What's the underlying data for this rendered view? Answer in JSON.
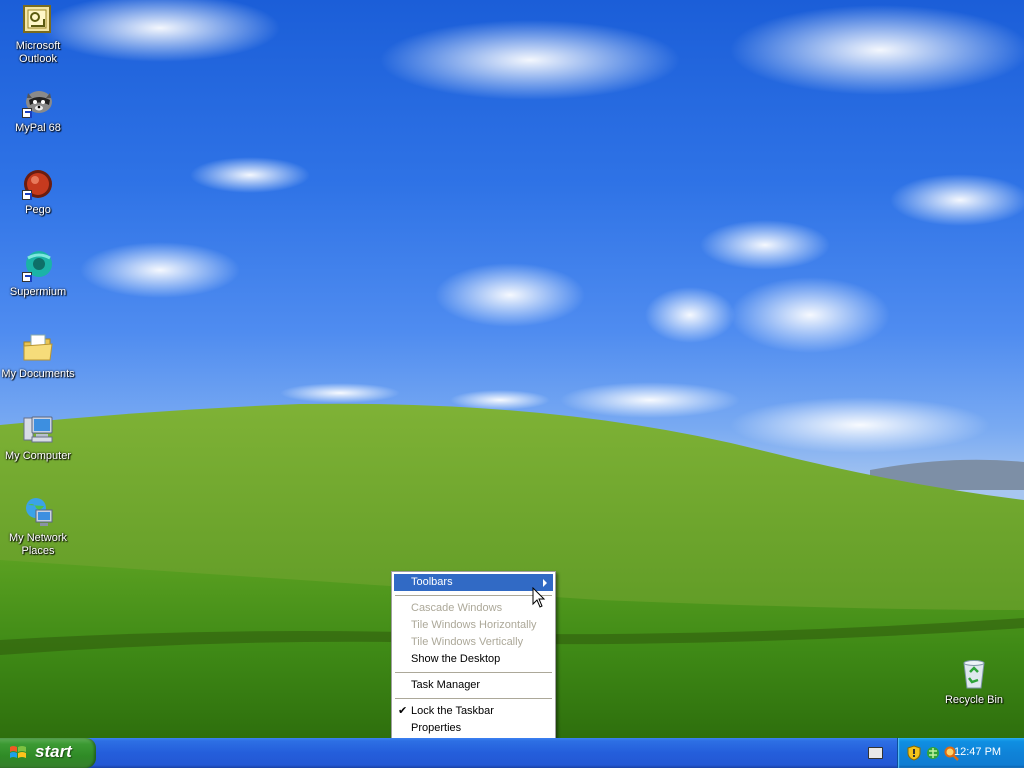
{
  "desktop": {
    "icons": [
      {
        "label": "Microsoft Outlook",
        "icon": "outlook-icon"
      },
      {
        "label": "MyPal 68",
        "icon": "mypal-icon"
      },
      {
        "label": "Pego",
        "icon": "pego-icon"
      },
      {
        "label": "Supermium",
        "icon": "supermium-icon"
      },
      {
        "label": "My Documents",
        "icon": "folder-icon"
      },
      {
        "label": "My Computer",
        "icon": "computer-icon"
      },
      {
        "label": "My Network Places",
        "icon": "network-icon"
      },
      {
        "label": "Recycle Bin",
        "icon": "recycle-bin-icon"
      }
    ]
  },
  "context_menu": {
    "items": [
      {
        "label": "Toolbars",
        "state": "highlighted",
        "submenu": true
      },
      {
        "label": "Cascade Windows",
        "state": "disabled"
      },
      {
        "label": "Tile Windows Horizontally",
        "state": "disabled"
      },
      {
        "label": "Tile Windows Vertically",
        "state": "disabled"
      },
      {
        "label": "Show the Desktop",
        "state": "enabled"
      },
      {
        "label": "Task Manager",
        "state": "enabled"
      },
      {
        "label": "Lock the Taskbar",
        "state": "checked"
      },
      {
        "label": "Properties",
        "state": "enabled"
      }
    ]
  },
  "taskbar": {
    "start_label": "start",
    "clock": "12:47 PM",
    "tray_icons": [
      "security-shield-icon",
      "network-status-icon",
      "search-icon"
    ]
  },
  "colors": {
    "menu_highlight": "#316ac5",
    "menu_disabled_text": "#aca899",
    "taskbar_blue": "#245edb",
    "start_green": "#3c9a33",
    "tray_blue": "#0f83d8"
  }
}
